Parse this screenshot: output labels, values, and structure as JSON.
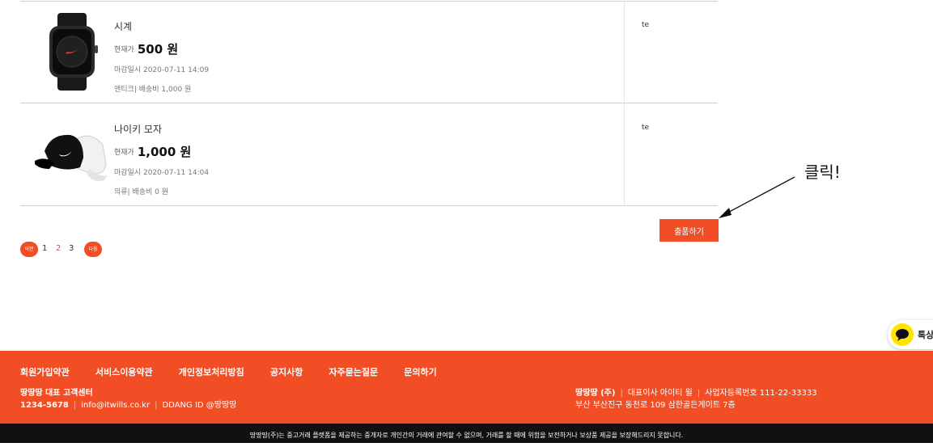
{
  "items": [
    {
      "title": "시계",
      "price_label": "현재가",
      "price": "500 원",
      "deadline": "마감일시 2020-07-11 14:09",
      "meta": "앤티크| 배송비 1,000 원",
      "seller": "te",
      "image": "smartwatch-image"
    },
    {
      "title": "나이키 모자",
      "price_label": "현재가",
      "price": "1,000 원",
      "deadline": "마감일시 2020-07-11 14:04",
      "meta": "의류| 배송비 0 원",
      "seller": "te",
      "image": "cap-image"
    }
  ],
  "submit_button": "출품하기",
  "annotation": "클릭!",
  "pagination": {
    "prev": "이전",
    "pages": [
      "1",
      "2",
      "3"
    ],
    "active_page": "2",
    "next": "다음"
  },
  "kakao_button": "톡상",
  "footer": {
    "links": [
      "회원가입약관",
      "서비스이용약관",
      "개인정보처리방침",
      "공지사항",
      "자주묻는질문",
      "문의하기"
    ],
    "cs_title": "땅땅땅 대표 고객센터",
    "phone": "1234-5678",
    "email": "info@itwills.co.kr",
    "kakao_id": "DDANG ID @땅땅땅",
    "company_name": "땅땅땅 (주)",
    "ceo": "대표이사 아이티 윌",
    "biz_no": "사업자등록번호 111-22-33333",
    "address": "부산 부산진구 동천로 109 삼한골든게이트 7층",
    "disclaimer": "땅땅땅(주)는 중고거래 플랫폼을 제공하는 중개자로 개인간의 거래에 관여할 수 없으며, 거래를 할 때에 위험을 보전하거나 보상품 제공을 보장해드리지 못합니다."
  },
  "colors": {
    "accent": "#f24e25",
    "footer_bg": "#f24e25",
    "bottom_bar": "#111111",
    "kakao_yellow": "#fee500"
  }
}
